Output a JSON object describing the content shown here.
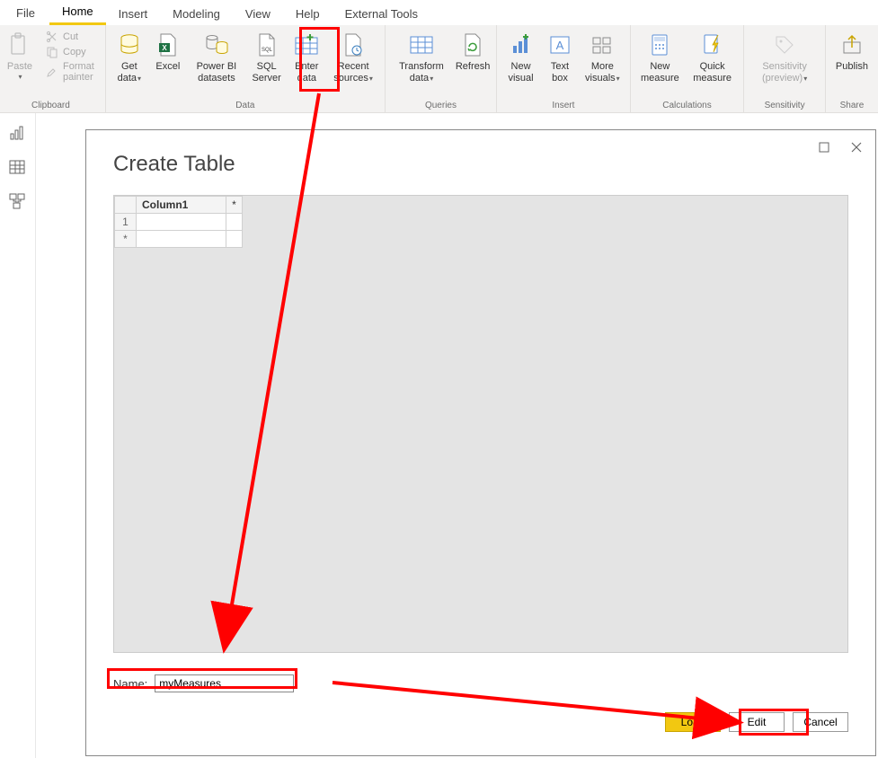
{
  "tabs": {
    "file": "File",
    "home": "Home",
    "insert": "Insert",
    "modeling": "Modeling",
    "view": "View",
    "help": "Help",
    "external": "External Tools"
  },
  "clipboard": {
    "paste": "Paste",
    "cut": "Cut",
    "copy": "Copy",
    "format_painter": "Format painter",
    "group": "Clipboard"
  },
  "data": {
    "get_data": "Get data",
    "excel": "Excel",
    "powerbi_ds": "Power BI datasets",
    "sql": "SQL Server",
    "enter_data": "Enter data",
    "recent": "Recent sources",
    "group": "Data"
  },
  "queries": {
    "transform": "Transform data",
    "refresh": "Refresh",
    "group": "Queries"
  },
  "insert": {
    "new_visual": "New visual",
    "text_box": "Text box",
    "more_visuals": "More visuals",
    "group": "Insert"
  },
  "calc": {
    "new_measure": "New measure",
    "quick_measure": "Quick measure",
    "group": "Calculations"
  },
  "sensitivity": {
    "label": "Sensitivity (preview)",
    "group": "Sensitivity"
  },
  "share": {
    "publish": "Publish",
    "group": "Share"
  },
  "dialog": {
    "title": "Create Table",
    "col1": "Column1",
    "star": "*",
    "row1": "1",
    "name_label": "Name:",
    "name_value": "myMeasures",
    "load": "Load",
    "edit": "Edit",
    "cancel": "Cancel"
  }
}
